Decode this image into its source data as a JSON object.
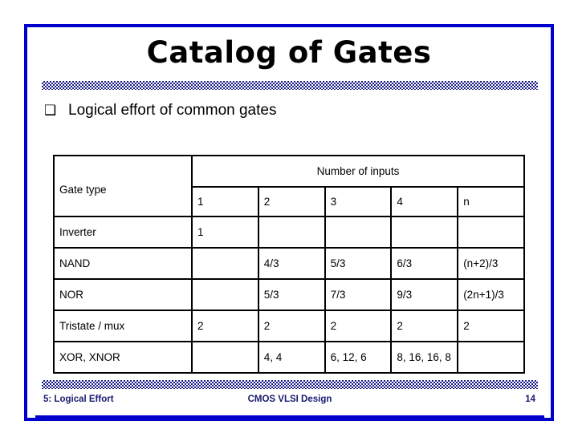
{
  "slide": {
    "title": "Catalog of Gates",
    "bullet_glyph": "❑",
    "bullet_text": "Logical effort of common gates",
    "border_color": "#0000cc",
    "band_color": "#1a1a8c",
    "footer_color": "#191970"
  },
  "table": {
    "type_header": "Gate type",
    "group_header": "Number of inputs",
    "columns": [
      "1",
      "2",
      "3",
      "4",
      "n"
    ],
    "rows": [
      {
        "type": "Inverter",
        "values": [
          "1",
          "",
          "",
          "",
          ""
        ]
      },
      {
        "type": "NAND",
        "values": [
          "",
          "4/3",
          "5/3",
          "6/3",
          "(n+2)/3"
        ]
      },
      {
        "type": "NOR",
        "values": [
          "",
          "5/3",
          "7/3",
          "9/3",
          "(2n+1)/3"
        ]
      },
      {
        "type": "Tristate / mux",
        "values": [
          "2",
          "2",
          "2",
          "2",
          "2"
        ]
      },
      {
        "type": "XOR, XNOR",
        "values": [
          "",
          "4, 4",
          "6, 12, 6",
          "8, 16, 16, 8",
          ""
        ]
      }
    ]
  },
  "footer": {
    "left": "5: Logical Effort",
    "center": "CMOS VLSI Design",
    "page": "14"
  }
}
